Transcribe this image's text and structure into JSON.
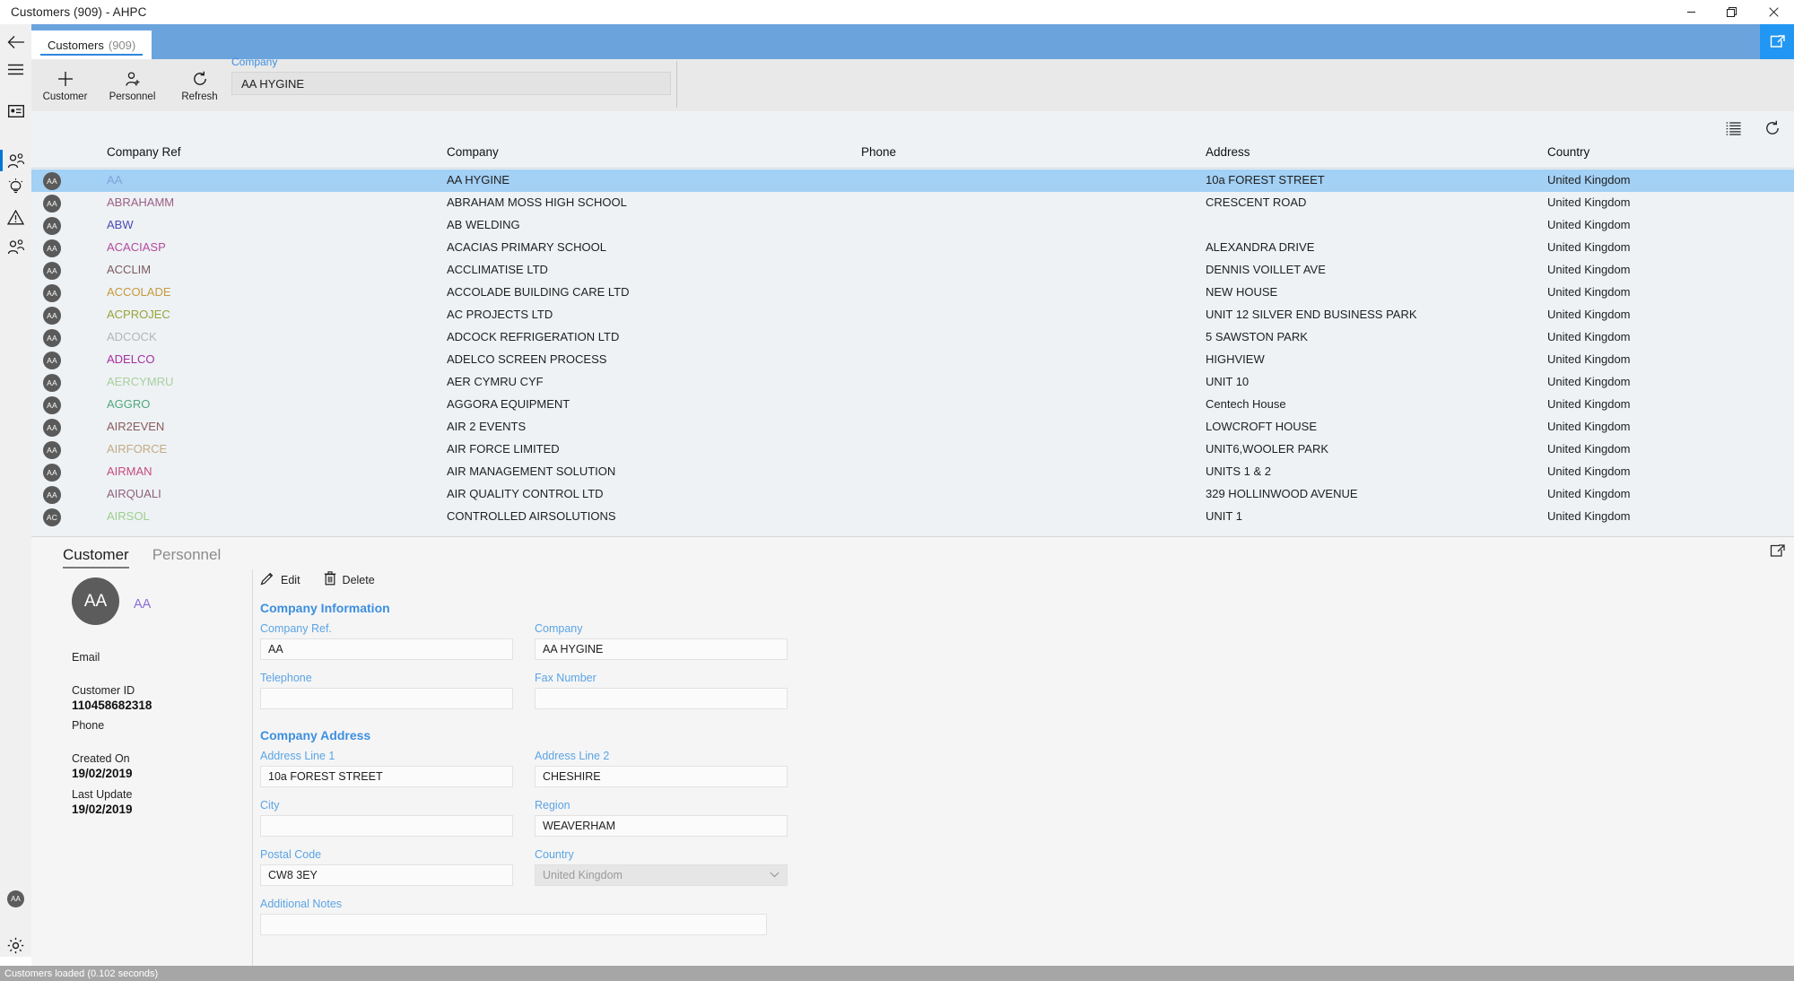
{
  "window": {
    "title": "Customers  (909) - AHPC",
    "controls": {
      "minimize": "minimize-icon",
      "restore": "restore-icon",
      "close": "close-icon"
    }
  },
  "rail": {
    "items": [
      {
        "name": "hamburger-icon"
      },
      {
        "name": "card-icon"
      },
      {
        "name": "people-icon",
        "selected": true
      },
      {
        "name": "lightbulb-icon"
      },
      {
        "name": "warning-icon"
      },
      {
        "name": "person-add-icon"
      }
    ],
    "bottom": {
      "avatar_initials": "AA",
      "gear": "gear-icon"
    }
  },
  "tabs": {
    "back": "back-arrow-icon",
    "items": [
      {
        "label": "Customers",
        "count": "(909)"
      }
    ],
    "expand": "popout-icon"
  },
  "toolbar": {
    "buttons": [
      {
        "label": "Customer",
        "icon": "plus-icon"
      },
      {
        "label": "Personnel",
        "icon": "person-add-icon"
      },
      {
        "label": "Refresh",
        "icon": "refresh-icon"
      }
    ],
    "company_label": "Company",
    "company_value": "AA HYGINE"
  },
  "grid": {
    "tools": [
      {
        "name": "list-view-icon"
      },
      {
        "name": "refresh-icon"
      }
    ],
    "columns": [
      "Company Ref",
      "Company",
      "Phone",
      "Address",
      "Country"
    ],
    "rows": [
      {
        "avatar": "AA",
        "ref": "AA",
        "ref_color": "#7ea3d9",
        "company": "AA HYGINE",
        "phone": "",
        "address": "10a FOREST STREET",
        "country": "United Kingdom",
        "selected": true
      },
      {
        "avatar": "AA",
        "ref": "ABRAHAMM",
        "ref_color": "#9c5f85",
        "company": "ABRAHAM MOSS HIGH SCHOOL",
        "phone": "",
        "address": "CRESCENT ROAD",
        "country": "United Kingdom"
      },
      {
        "avatar": "AA",
        "ref": "ABW",
        "ref_color": "#4b49b5",
        "company": "AB WELDING",
        "phone": "",
        "address": "",
        "country": "United Kingdom"
      },
      {
        "avatar": "AA",
        "ref": "ACACIASP",
        "ref_color": "#b4499b",
        "company": "ACACIAS PRIMARY SCHOOL",
        "phone": "",
        "address": "ALEXANDRA DRIVE",
        "country": "United Kingdom"
      },
      {
        "avatar": "AA",
        "ref": "ACCLIM",
        "ref_color": "#7a5a5a",
        "company": "ACCLIMATISE LTD",
        "phone": "",
        "address": "DENNIS VOILLET AVE",
        "country": "United Kingdom"
      },
      {
        "avatar": "AA",
        "ref": "ACCOLADE",
        "ref_color": "#c79a3d",
        "company": "ACCOLADE BUILDING CARE LTD",
        "phone": "",
        "address": "NEW HOUSE",
        "country": "United Kingdom"
      },
      {
        "avatar": "AA",
        "ref": "ACPROJEC",
        "ref_color": "#9aa23a",
        "company": "AC PROJECTS LTD",
        "phone": "",
        "address": "UNIT 12 SILVER END BUSINESS PARK",
        "country": "United Kingdom"
      },
      {
        "avatar": "AA",
        "ref": "ADCOCK",
        "ref_color": "#b4b4b4",
        "company": "ADCOCK REFRIGERATION LTD",
        "phone": "",
        "address": "5 SAWSTON PARK",
        "country": "United Kingdom"
      },
      {
        "avatar": "AA",
        "ref": "ADELCO",
        "ref_color": "#a62fa0",
        "company": "ADELCO SCREEN PROCESS",
        "phone": "",
        "address": "HIGHVIEW",
        "country": "United Kingdom"
      },
      {
        "avatar": "AA",
        "ref": "AERCYMRU",
        "ref_color": "#a9cf9d",
        "company": "AER CYMRU CYF",
        "phone": "",
        "address": "UNIT 10",
        "country": "United Kingdom"
      },
      {
        "avatar": "AA",
        "ref": "AGGRO",
        "ref_color": "#4fa87d",
        "company": "AGGORA EQUIPMENT",
        "phone": "",
        "address": "Centech House",
        "country": "United Kingdom"
      },
      {
        "avatar": "AA",
        "ref": "AIR2EVEN",
        "ref_color": "#8a5b5b",
        "company": "AIR 2 EVENTS",
        "phone": "",
        "address": "LOWCROFT HOUSE",
        "country": "United Kingdom"
      },
      {
        "avatar": "AA",
        "ref": "AIRFORCE",
        "ref_color": "#c2ab83",
        "company": "AIR FORCE LIMITED",
        "phone": "",
        "address": "UNIT6,WOOLER PARK",
        "country": "United Kingdom"
      },
      {
        "avatar": "AA",
        "ref": "AIRMAN",
        "ref_color": "#c54b7e",
        "company": "AIR MANAGEMENT SOLUTION",
        "phone": "",
        "address": "UNITS 1 & 2",
        "country": "United Kingdom"
      },
      {
        "avatar": "AA",
        "ref": "AIRQUALI",
        "ref_color": "#8f5f7a",
        "company": "AIR QUALITY CONTROL LTD",
        "phone": "",
        "address": "329 HOLLINWOOD AVENUE",
        "country": "United Kingdom"
      },
      {
        "avatar": "AC",
        "ref": "AIRSOL",
        "ref_color": "#9dcf8d",
        "company": "CONTROLLED AIRSOLUTIONS",
        "phone": "",
        "address": "UNIT 1",
        "country": "United Kingdom"
      }
    ]
  },
  "detail": {
    "tabs": [
      {
        "label": "Customer",
        "active": true
      },
      {
        "label": "Personnel",
        "active": false
      }
    ],
    "expand_icon": "popout-icon",
    "summary": {
      "avatar_initials": "AA",
      "name": "AA",
      "fields": [
        {
          "label": "Email",
          "value": ""
        },
        {
          "label": "Customer ID",
          "value": "110458682318"
        },
        {
          "label": "Phone",
          "value": ""
        },
        {
          "label": "Created On",
          "value": "19/02/2019"
        },
        {
          "label": "Last Update",
          "value": "19/02/2019"
        }
      ]
    },
    "actions": [
      {
        "label": "Edit",
        "icon": "pencil-icon"
      },
      {
        "label": "Delete",
        "icon": "trash-icon"
      }
    ],
    "sections": [
      {
        "title": "Company Information",
        "fields": [
          {
            "label": "Company Ref.",
            "value": "AA",
            "disabled": false
          },
          {
            "label": "Company",
            "value": "AA HYGINE",
            "disabled": false
          },
          {
            "label": "Telephone",
            "value": "",
            "disabled": false
          },
          {
            "label": "Fax Number",
            "value": "",
            "disabled": false
          }
        ]
      },
      {
        "title": "Company Address",
        "fields": [
          {
            "label": "Address Line 1",
            "value": "10a FOREST STREET",
            "disabled": false
          },
          {
            "label": "Address Line 2",
            "value": "CHESHIRE",
            "disabled": false
          },
          {
            "label": "City",
            "value": "",
            "disabled": false
          },
          {
            "label": "Region",
            "value": "WEAVERHAM",
            "disabled": false
          },
          {
            "label": "Postal Code",
            "value": "CW8 3EY",
            "disabled": false
          },
          {
            "label": "Country",
            "value": "United Kingdom",
            "disabled": true
          }
        ]
      }
    ],
    "notes": {
      "label": "Additional Notes",
      "value": ""
    }
  },
  "statusbar": {
    "text": "Customers loaded (0.102 seconds)"
  },
  "colors": {
    "accent_blue": "#2196f3",
    "band_blue": "#6ba4dd",
    "label_blue": "#5ba4e5",
    "selection_blue": "#a3d0f5",
    "grid_bg": "#eef2f5",
    "status_bg": "#a6a6a6"
  }
}
